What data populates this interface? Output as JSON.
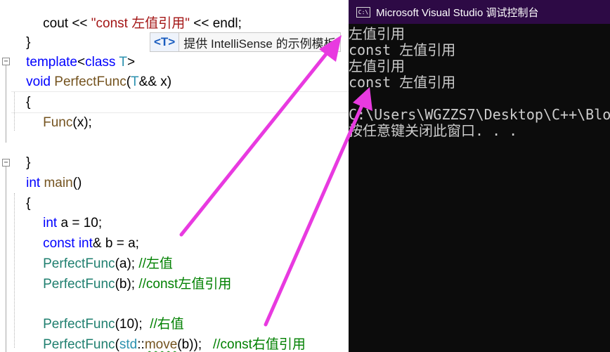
{
  "editor": {
    "cout_line": {
      "cout": "cout",
      "op1": " << ",
      "str": "\"const 左值引用\"",
      "op2": " << ",
      "endl": "endl;"
    },
    "brace_close1": "}",
    "template_line": {
      "kw": "template",
      "lt": "<",
      "kw2": "class",
      "sp": " ",
      "t": "T",
      "gt": ">"
    },
    "hint": {
      "badge": "<T>",
      "text": "提供 IntelliSense 的示例模板"
    },
    "perfect_sig": {
      "ret": "void",
      "name": "PerfectFunc",
      "open": "(",
      "t": "T",
      "ref": "&& ",
      "param": "x",
      "close": ")"
    },
    "brace_open1": "{",
    "func_call": {
      "name": "Func",
      "args": "(x);"
    },
    "brace_close2": "}",
    "main_sig": {
      "ret": "int",
      "name": "main",
      "parens": "()"
    },
    "brace_open2": "{",
    "line_a": {
      "kw": "int",
      "rest": " a = 10;"
    },
    "line_b": {
      "kw1": "const",
      "sp": " ",
      "kw2": "int",
      "rest": "& b = a;"
    },
    "call1": {
      "name": "PerfectFunc",
      "args": "(a); ",
      "comment": "//左值"
    },
    "call2": {
      "name": "PerfectFunc",
      "args": "(b); ",
      "comment": "//const左值引用"
    },
    "call3": {
      "name": "PerfectFunc",
      "args": "(10);  ",
      "comment": "//右值"
    },
    "call4": {
      "name": "PerfectFunc",
      "open": "(",
      "ns": "std",
      "sep": "::",
      "fn": "move",
      "args": "(b));   ",
      "comment": "//const右值引用"
    }
  },
  "console": {
    "title": "Microsoft Visual Studio 调试控制台",
    "icon_label": "C:\\",
    "lines": [
      "左值引用",
      "const 左值引用",
      "左值引用",
      "const 左值引用",
      "",
      "C:\\Users\\WGZZS7\\Desktop\\C++\\Blo",
      "按任意键关闭此窗口. . ."
    ]
  },
  "colors": {
    "arrow": "#e83ae0",
    "console_title_bg": "#2d0a45",
    "console_bg": "#0c0c0c"
  }
}
